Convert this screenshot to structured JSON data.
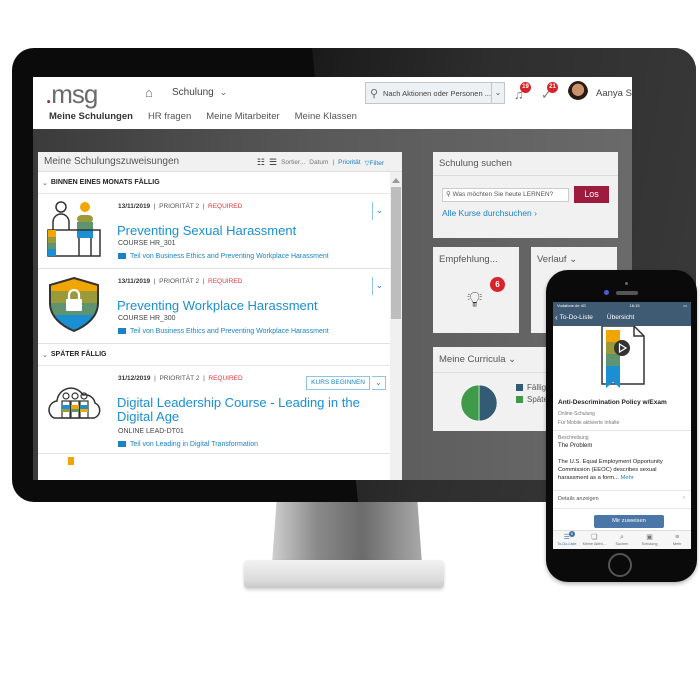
{
  "app": {
    "logo": "msg",
    "nav_menu": "Schulung",
    "search_placeholder": "Nach Aktionen oder Personen ...",
    "notifications_count": "19",
    "tasks_count": "21",
    "user_name": "Aanya Singh (sfa",
    "tabs": [
      {
        "label": "Meine Schulungen",
        "active": true
      },
      {
        "label": "HR fragen"
      },
      {
        "label": "Meine Mitarbeiter"
      },
      {
        "label": "Meine Klassen"
      }
    ]
  },
  "assignments": {
    "title": "Meine Schulungszuweisungen",
    "sort_label": "Sortier...",
    "sort_date": "Datum",
    "sort_separator": "|",
    "sort_priority": "Priorität",
    "filter_label": "Filter",
    "sections": [
      {
        "label": "BINNEN EINES MONATS FÄLLIG",
        "items": [
          {
            "date": "13/11/2019",
            "priority": "PRIORITÄT 2",
            "status": "REQUIRED",
            "title": "Preventing Sexual Harassment",
            "code": "COURSE HR_301",
            "part_of": "Teil von Business Ethics and Preventing Workplace Harassment",
            "icon": "people-desk-icon"
          },
          {
            "date": "13/11/2019",
            "priority": "PRIORITÄT 2",
            "status": "REQUIRED",
            "title": "Preventing Workplace Harassment",
            "code": "COURSE HR_300",
            "part_of": "Teil von Business Ethics and Preventing Workplace Harassment",
            "icon": "shield-lock-icon"
          }
        ]
      },
      {
        "label": "SPÄTER FÄLLIG",
        "items": [
          {
            "date": "31/12/2019",
            "priority": "PRIORITÄT 2",
            "status": "REQUIRED",
            "title": "Digital Leadership Course - Leading in the Digital Age",
            "code": "ONLINE LEAD-DT01",
            "part_of": "Teil von Leading in Digital Transformation",
            "icon": "cloud-people-icon",
            "action": "KURS BEGINNEN"
          }
        ]
      }
    ]
  },
  "search_card": {
    "title": "Schulung suchen",
    "placeholder": "Was möchten Sie heute LERNEN?",
    "button": "Los",
    "browse_link": "Alle Kurse durchsuchen"
  },
  "recommend_card": {
    "title": "Empfehlung...",
    "count": "6"
  },
  "history_card": {
    "title": "Verlauf"
  },
  "curricula_card": {
    "title": "Meine Curricula",
    "legend": [
      {
        "label": "Fällig",
        "color": "#335b74"
      },
      {
        "label": "Später",
        "color": "#3f9a4a"
      }
    ],
    "pie": [
      {
        "label": "Fällig",
        "value": 50,
        "color": "#335b74"
      },
      {
        "label": "Später",
        "value": 50,
        "color": "#3f9a4a"
      }
    ]
  },
  "phone": {
    "carrier": "Vodafone.de 4G",
    "time": "16:15",
    "back_label": "To-Do-Liste",
    "nav_title": "Übersicht",
    "course_title": "Anti-Descrimination Policy w/Exam",
    "type": "Online-Schulung",
    "mobile_note": "Für Mobile aktivierte Inhalte",
    "desc_label": "Beschreibung",
    "desc_title": "The Problem",
    "desc_text": "The U.S. Equal Employment Opportunity Commission (EEOC) describes sexual harassment as a form...",
    "more": "Mehr",
    "details": "Details anzeigen",
    "assign_button": "Mir zuweisen",
    "tabs": [
      {
        "label": "To-Do-Liste",
        "glyph": "☰",
        "badge": "6",
        "active": true
      },
      {
        "label": "Meine Aktivi...",
        "glyph": "❏"
      },
      {
        "label": "Suchen",
        "glyph": "⌕"
      },
      {
        "label": "Schulung",
        "glyph": "▣"
      },
      {
        "label": "Mehr",
        "glyph": "≡"
      }
    ]
  }
}
